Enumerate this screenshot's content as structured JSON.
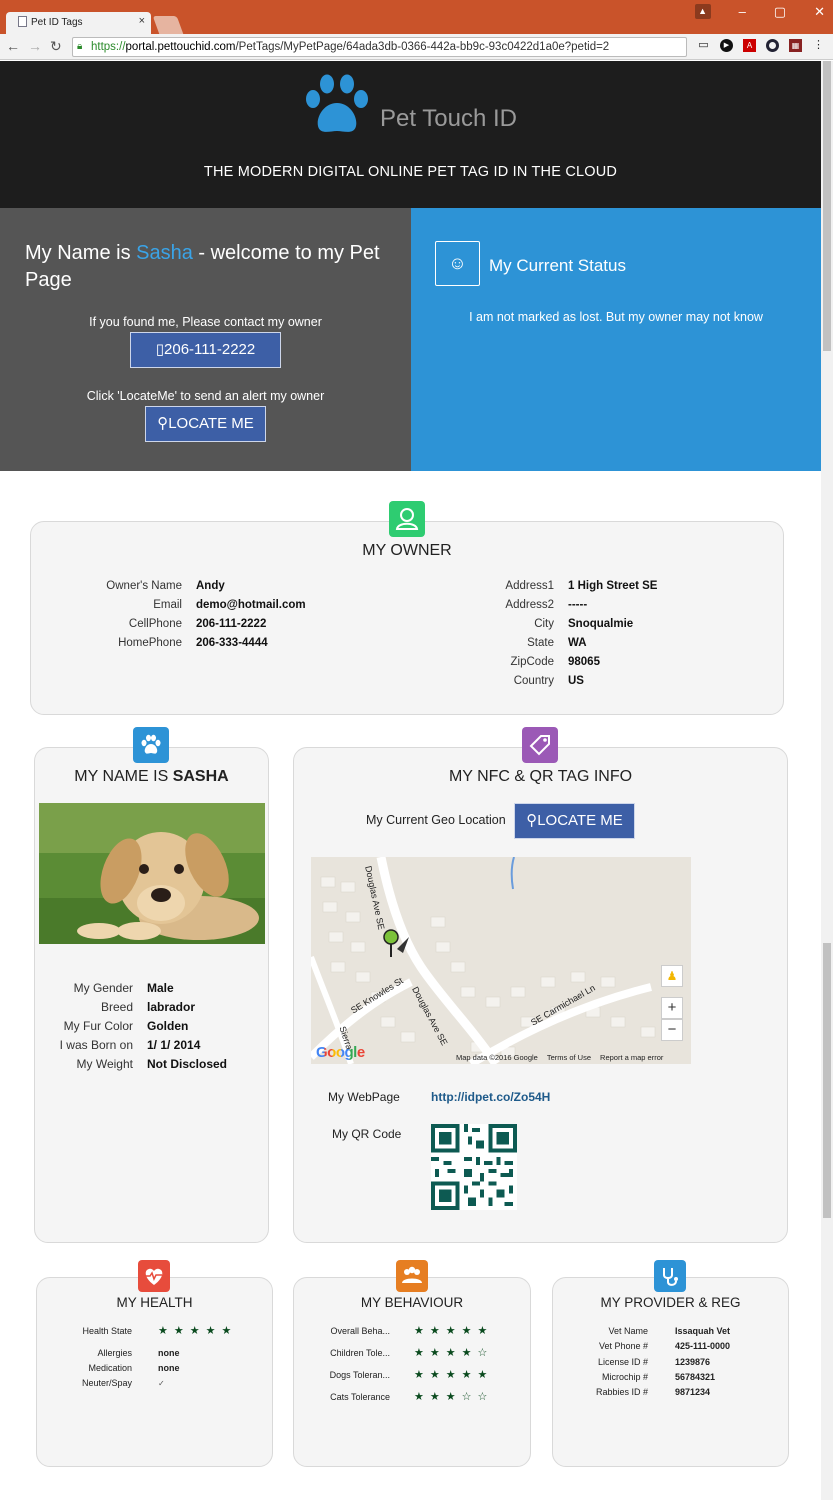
{
  "browser": {
    "tab_title": "Pet ID Tags",
    "tab_close": "×",
    "url_scheme": "https://",
    "url_domain": "portal.pettouchid.com",
    "url_path": "/PetTags/MyPetPage/64ada3db-0366-442a-bb9c-93c0422d1a0e?petid=2",
    "window_controls": [
      "–",
      "▢",
      "✕"
    ]
  },
  "hero": {
    "brand": "Pet Touch ID",
    "tagline": "THE MODERN DIGITAL ONLINE PET TAG ID IN THE CLOUD"
  },
  "welcome": {
    "prefix": "My Name is ",
    "pet_name": "Sasha",
    "suffix": " - welcome to my Pet Page",
    "contact_note": "If you found me, Please contact my owner",
    "phone_button": "206-111-2222",
    "locate_note": "Click 'LocateMe' to send an alert my owner",
    "locate_button": "LOCATE ME"
  },
  "status": {
    "title": "My Current Status",
    "text": "I am not marked as lost. But my owner may not know"
  },
  "owner": {
    "title": "MY OWNER",
    "left": [
      {
        "k": "Owner's Name",
        "v": "Andy"
      },
      {
        "k": "Email",
        "v": "demo@hotmail.com"
      },
      {
        "k": "CellPhone",
        "v": "206-111-2222"
      },
      {
        "k": "HomePhone",
        "v": "206-333-4444"
      }
    ],
    "right": [
      {
        "k": "Address1",
        "v": "1 High Street SE"
      },
      {
        "k": "Address2",
        "v": "-----"
      },
      {
        "k": "City",
        "v": "Snoqualmie"
      },
      {
        "k": "State",
        "v": "WA"
      },
      {
        "k": "ZipCode",
        "v": "98065"
      },
      {
        "k": "Country",
        "v": "US"
      }
    ]
  },
  "pet": {
    "title_prefix": "MY NAME IS ",
    "title_name": "SASHA",
    "fields": [
      {
        "k": "My Gender",
        "v": "Male"
      },
      {
        "k": "Breed",
        "v": "labrador"
      },
      {
        "k": "My Fur Color",
        "v": "Golden"
      },
      {
        "k": "I was Born on",
        "v": "1/ 1/ 2014"
      },
      {
        "k": "My Weight",
        "v": "Not Disclosed"
      }
    ]
  },
  "nfc": {
    "title": "MY NFC & QR TAG INFO",
    "geo_label": "My Current Geo Location",
    "locate_button": "LOCATE ME",
    "map": {
      "streets": [
        "Douglas Ave SE",
        "SE Knowles St",
        "Douglas Ave SE",
        "SE Carmichael Ln",
        "Sierra"
      ],
      "logo": "Google",
      "attribution": [
        "Map data ©2016 Google",
        "Terms of Use",
        "Report a map error"
      ],
      "zoom_in": "+",
      "zoom_out": "−"
    },
    "webpage_label": "My WebPage",
    "webpage_url": "http://idpet.co/Zo54H",
    "qr_label": "My QR Code"
  },
  "health": {
    "title": "MY HEALTH",
    "rows": [
      {
        "k": "Health State",
        "rating": 5
      },
      {
        "k": "Allergies",
        "v": "none"
      },
      {
        "k": "Medication",
        "v": "none"
      },
      {
        "k": "Neuter/Spay",
        "v": "✓"
      }
    ]
  },
  "behaviour": {
    "title": "MY BEHAVIOUR",
    "rows": [
      {
        "k": "Overall Beha...",
        "rating": 5
      },
      {
        "k": "Children Tole...",
        "rating": 4
      },
      {
        "k": "Dogs Toleran...",
        "rating": 5
      },
      {
        "k": "Cats Tolerance",
        "rating": 3
      }
    ]
  },
  "provider": {
    "title": "MY PROVIDER & REG",
    "rows": [
      {
        "k": "Vet Name",
        "v": "Issaquah Vet"
      },
      {
        "k": "Vet Phone #",
        "v": "425-111-0000"
      },
      {
        "k": "License ID #",
        "v": "1239876"
      },
      {
        "k": "Microchip #",
        "v": "56784321"
      },
      {
        "k": "Rabbies ID #",
        "v": "9871234"
      }
    ]
  },
  "colors": {
    "accent_blue": "#2d93d6",
    "button_blue": "#3d5fa6",
    "owner_badge": "#2ecc71",
    "pet_badge": "#2d93d6",
    "nfc_badge": "#9b59b6",
    "health_badge": "#e74c3c",
    "behaviour_badge": "#e67e22",
    "provider_badge": "#2d93d6"
  }
}
